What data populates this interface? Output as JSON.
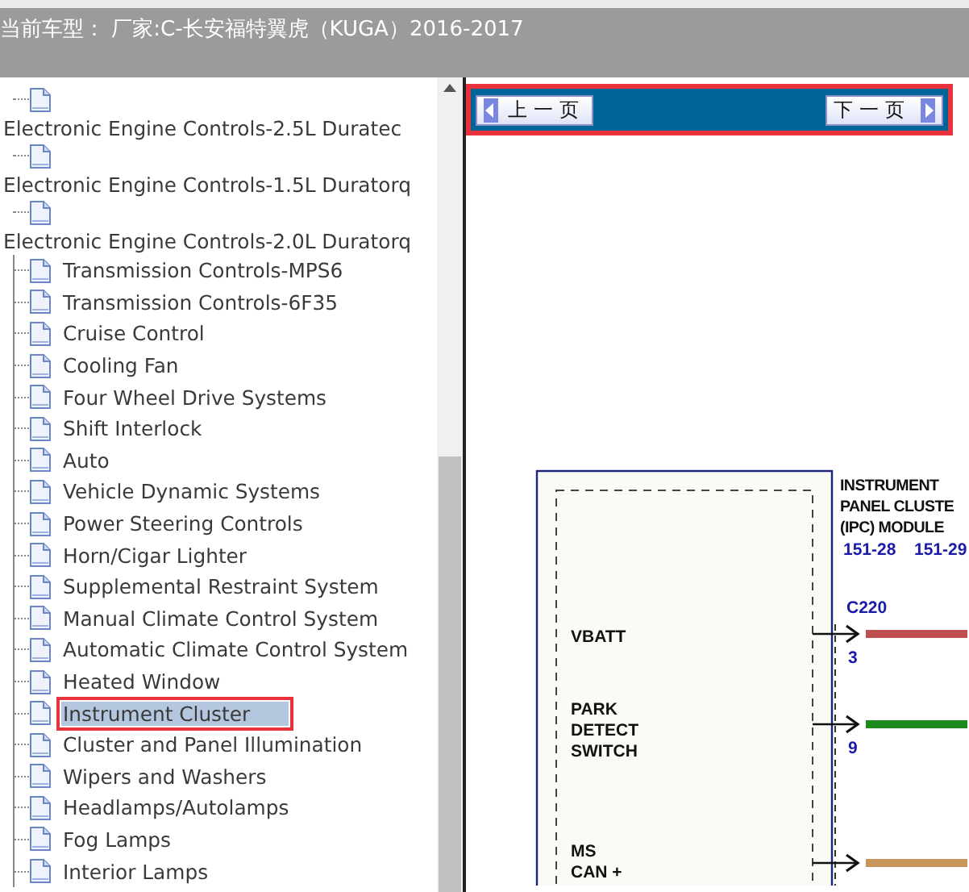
{
  "header": {
    "title": "当前车型： 厂家:C-长安福特翼虎（KUGA）2016-2017"
  },
  "tree": {
    "items": [
      {
        "kind": "wrapped",
        "label": "Electronic Engine Controls-2.5L Duratec",
        "selected": false
      },
      {
        "kind": "wrapped",
        "label": "Electronic Engine Controls-1.5L Duratorq",
        "selected": false
      },
      {
        "kind": "wrapped",
        "label": "Electronic Engine Controls-2.0L Duratorq",
        "selected": false
      },
      {
        "kind": "leaf",
        "label": "Transmission Controls-MPS6",
        "selected": false
      },
      {
        "kind": "leaf",
        "label": "Transmission Controls-6F35",
        "selected": false
      },
      {
        "kind": "leaf",
        "label": "Cruise Control",
        "selected": false
      },
      {
        "kind": "leaf",
        "label": "Cooling Fan",
        "selected": false
      },
      {
        "kind": "leaf",
        "label": "Four Wheel Drive Systems",
        "selected": false
      },
      {
        "kind": "leaf",
        "label": "Shift Interlock",
        "selected": false
      },
      {
        "kind": "leaf",
        "label": "Auto",
        "selected": false
      },
      {
        "kind": "leaf",
        "label": "Vehicle Dynamic Systems",
        "selected": false
      },
      {
        "kind": "leaf",
        "label": "Power Steering Controls",
        "selected": false
      },
      {
        "kind": "leaf",
        "label": "Horn/Cigar Lighter",
        "selected": false
      },
      {
        "kind": "leaf",
        "label": "Supplemental Restraint System",
        "selected": false
      },
      {
        "kind": "leaf",
        "label": "Manual Climate Control System",
        "selected": false
      },
      {
        "kind": "leaf",
        "label": "Automatic Climate Control System",
        "selected": false
      },
      {
        "kind": "leaf",
        "label": "Heated Window",
        "selected": false
      },
      {
        "kind": "leaf",
        "label": "Instrument Cluster",
        "selected": true
      },
      {
        "kind": "leaf",
        "label": "Cluster and Panel Illumination",
        "selected": false
      },
      {
        "kind": "leaf",
        "label": "Wipers and Washers",
        "selected": false
      },
      {
        "kind": "leaf",
        "label": "Headlamps/Autolamps",
        "selected": false
      },
      {
        "kind": "leaf",
        "label": "Fog Lamps",
        "selected": false
      },
      {
        "kind": "leaf",
        "label": "Interior Lamps",
        "selected": false
      }
    ]
  },
  "viewer": {
    "prev_button": "上一页",
    "next_button": "下一页",
    "diagram": {
      "module_title": [
        "INSTRUMENT",
        "PANEL CLUSTE",
        "(IPC) MODULE"
      ],
      "pages": [
        "151-28",
        "151-29"
      ],
      "connector": "C220",
      "pins": [
        {
          "label": [
            "VBATT"
          ],
          "pin": "3",
          "color": "#c0504d"
        },
        {
          "label": [
            "PARK",
            "DETECT",
            "SWITCH"
          ],
          "pin": "9",
          "color": "#1e8a1e"
        },
        {
          "label": [
            "MS",
            "CAN +"
          ],
          "color": "#c8955a"
        }
      ]
    }
  }
}
